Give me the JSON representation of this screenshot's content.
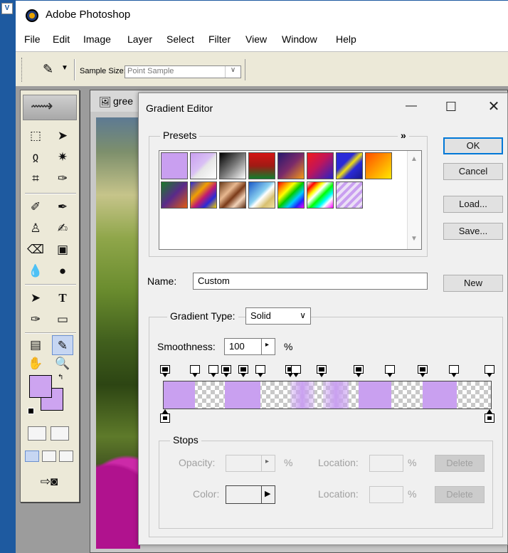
{
  "app": {
    "title": "Adobe Photoshop"
  },
  "menu": [
    "File",
    "Edit",
    "Image",
    "Layer",
    "Select",
    "Filter",
    "View",
    "Window",
    "Help"
  ],
  "options_bar": {
    "sample_size_label": "Sample Size:",
    "sample_size_value": "Point Sample"
  },
  "document": {
    "title": "gree"
  },
  "gradient_editor": {
    "title": "Gradient Editor",
    "presets_label": "Presets",
    "presets_menu_glyph": "»",
    "buttons": {
      "ok": "OK",
      "cancel": "Cancel",
      "load": "Load...",
      "save": "Save...",
      "new": "New",
      "delete_opacity": "Delete",
      "delete_color": "Delete"
    },
    "name_label": "Name:",
    "name_value": "Custom",
    "gradient_type_label": "Gradient Type:",
    "gradient_type_value": "Solid",
    "smoothness_label": "Smoothness:",
    "smoothness_value": "100",
    "smoothness_unit": "%",
    "stops_label": "Stops",
    "opacity_label": "Opacity:",
    "opacity_unit": "%",
    "color_label": "Color:",
    "location_label": "Location:",
    "location_unit": "%"
  },
  "colors": {
    "accent": "#0078d7",
    "lilac": "#c9a0f0"
  }
}
